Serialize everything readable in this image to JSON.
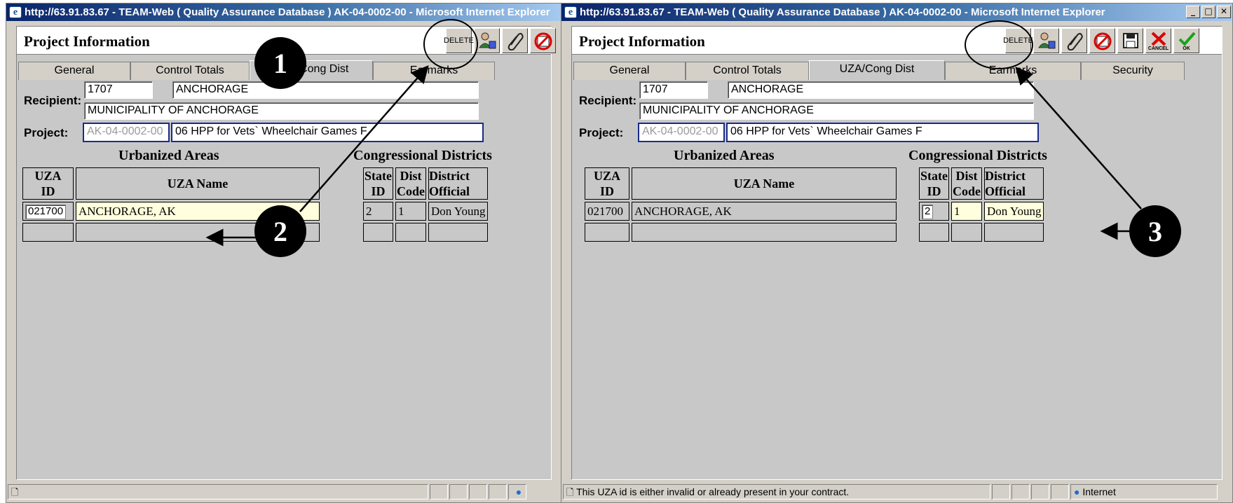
{
  "windows": [
    {
      "id": "left",
      "title": "http://63.91.83.67 - TEAM-Web ( Quality Assurance Database ) AK-04-0002-00 - Microsoft Internet Explorer",
      "page_title": "Project Information",
      "toolbar": {
        "delete_label": "DELETE"
      },
      "tabs": [
        "General",
        "Control Totals",
        "UZA/Cong Dist",
        "Earmarks"
      ],
      "active_tab": "UZA/Cong Dist",
      "recipient_label": "Recipient:",
      "recipient_id": "1707",
      "recipient_city": "ANCHORAGE",
      "recipient_name": "MUNICIPALITY OF ANCHORAGE",
      "project_label": "Project:",
      "project_id": "AK-04-0002-00",
      "project_desc": "06 HPP for Vets` Wheelchair Games F",
      "urbanized_areas": {
        "title": "Urbanized Areas",
        "col_id": "UZA\nID",
        "col_name": "UZA Name",
        "rows": [
          {
            "id": "021700",
            "name": "ANCHORAGE, AK"
          },
          {
            "id": "",
            "name": ""
          }
        ]
      },
      "congressional_districts": {
        "title": "Congressional Districts",
        "col_state": "State\nID",
        "col_dist": "Dist\nCode",
        "col_official": "District\nOfficial",
        "rows": [
          {
            "state": "2",
            "dist": "1",
            "official": "Don Young"
          },
          {
            "state": "",
            "dist": "",
            "official": ""
          }
        ]
      },
      "status_text": ""
    },
    {
      "id": "right",
      "title": "http://63.91.83.67 - TEAM-Web ( Quality Assurance Database ) AK-04-0002-00 - Microsoft Internet Explorer",
      "page_title": "Project Information",
      "toolbar": {
        "delete_label": "DELETE",
        "cancel_label": "CANCEL",
        "ok_label": "OK"
      },
      "tabs": [
        "General",
        "Control Totals",
        "UZA/Cong Dist",
        "Earmarks",
        "Security"
      ],
      "active_tab": "UZA/Cong Dist",
      "recipient_label": "Recipient:",
      "recipient_id": "1707",
      "recipient_city": "ANCHORAGE",
      "recipient_name": "MUNICIPALITY OF ANCHORAGE",
      "project_label": "Project:",
      "project_id": "AK-04-0002-00",
      "project_desc": "06 HPP for Vets` Wheelchair Games F",
      "urbanized_areas": {
        "title": "Urbanized Areas",
        "col_id": "UZA\nID",
        "col_name": "UZA Name",
        "rows": [
          {
            "id": "021700",
            "name": "ANCHORAGE, AK"
          },
          {
            "id": "",
            "name": ""
          }
        ]
      },
      "congressional_districts": {
        "title": "Congressional Districts",
        "col_state": "State\nID",
        "col_dist": "Dist\nCode",
        "col_official": "District\nOfficial",
        "rows": [
          {
            "state": "2",
            "dist": "1",
            "official": "Don Young"
          },
          {
            "state": "",
            "dist": "",
            "official": ""
          }
        ]
      },
      "status_text": "This UZA id is either invalid or already present in your contract.",
      "zone_text": "Internet"
    }
  ],
  "callouts": [
    "1",
    "2",
    "3"
  ],
  "colors": {
    "titlebar_start": "#0a246a",
    "titlebar_end": "#a6caf0",
    "window_bg": "#c8c8c8",
    "highlight_row": "#ffffdd",
    "field_frame": "#1a2a8a"
  },
  "icons": [
    "ie-page-icon",
    "delete-icon",
    "user-edit-icon",
    "attach-icon",
    "no-print-icon",
    "save-icon",
    "cancel-icon",
    "ok-icon",
    "internet-zone-icon"
  ]
}
